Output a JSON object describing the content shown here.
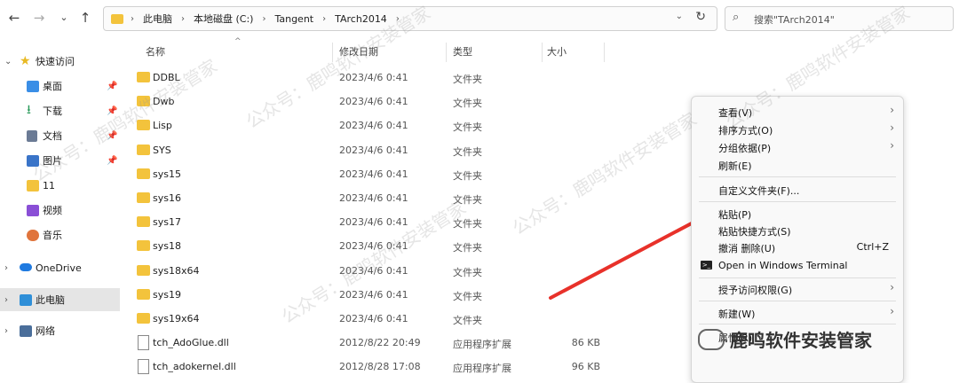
{
  "address": {
    "crumbs": [
      "此电脑",
      "本地磁盘 (C:)",
      "Tangent",
      "TArch2014"
    ]
  },
  "search": {
    "placeholder": "搜索\"TArch2014\""
  },
  "sidebar": {
    "items": [
      {
        "label": "快速访问",
        "pin": false
      },
      {
        "label": "桌面",
        "pin": true
      },
      {
        "label": "下载",
        "pin": true
      },
      {
        "label": "文档",
        "pin": true
      },
      {
        "label": "图片",
        "pin": true
      },
      {
        "label": "11",
        "pin": false
      },
      {
        "label": "视频",
        "pin": false
      },
      {
        "label": "音乐",
        "pin": false
      },
      {
        "label": "OneDrive",
        "pin": false
      },
      {
        "label": "此电脑",
        "pin": false
      },
      {
        "label": "网络",
        "pin": false
      }
    ]
  },
  "columns": {
    "name": "名称",
    "date": "修改日期",
    "type": "类型",
    "size": "大小"
  },
  "files": [
    {
      "name": "DDBL",
      "date": "2023/4/6 0:41",
      "type": "文件夹",
      "size": ""
    },
    {
      "name": "Dwb",
      "date": "2023/4/6 0:41",
      "type": "文件夹",
      "size": ""
    },
    {
      "name": "Lisp",
      "date": "2023/4/6 0:41",
      "type": "文件夹",
      "size": ""
    },
    {
      "name": "SYS",
      "date": "2023/4/6 0:41",
      "type": "文件夹",
      "size": ""
    },
    {
      "name": "sys15",
      "date": "2023/4/6 0:41",
      "type": "文件夹",
      "size": ""
    },
    {
      "name": "sys16",
      "date": "2023/4/6 0:41",
      "type": "文件夹",
      "size": ""
    },
    {
      "name": "sys17",
      "date": "2023/4/6 0:41",
      "type": "文件夹",
      "size": ""
    },
    {
      "name": "sys18",
      "date": "2023/4/6 0:41",
      "type": "文件夹",
      "size": ""
    },
    {
      "name": "sys18x64",
      "date": "2023/4/6 0:41",
      "type": "文件夹",
      "size": ""
    },
    {
      "name": "sys19",
      "date": "2023/4/6 0:41",
      "type": "文件夹",
      "size": ""
    },
    {
      "name": "sys19x64",
      "date": "2023/4/6 0:41",
      "type": "文件夹",
      "size": ""
    },
    {
      "name": "tch_AdoGlue.dll",
      "date": "2012/8/22 20:49",
      "type": "应用程序扩展",
      "size": "86 KB"
    },
    {
      "name": "tch_adokernel.dll",
      "date": "2012/8/28 17:08",
      "type": "应用程序扩展",
      "size": "96 KB"
    }
  ],
  "context_menu": {
    "view": "查看(V)",
    "sort": "排序方式(O)",
    "group": "分组依据(P)",
    "refresh": "刷新(E)",
    "customize": "自定义文件夹(F)...",
    "paste": "粘贴(P)",
    "paste_shortcut": "粘贴快捷方式(S)",
    "undo": "撤消 删除(U)",
    "undo_shortcut": "Ctrl+Z",
    "terminal": "Open in Windows Terminal",
    "access": "授予访问权限(G)",
    "new": "新建(W)",
    "properties": "属性(R)"
  },
  "watermark": {
    "text": "公众号：鹿鸣软件安装管家",
    "brand": "鹿鸣软件安装管家"
  },
  "colors": {
    "folder": "#f3c33c",
    "arrow": "#e8312a",
    "selection": "#e5e5e5"
  }
}
